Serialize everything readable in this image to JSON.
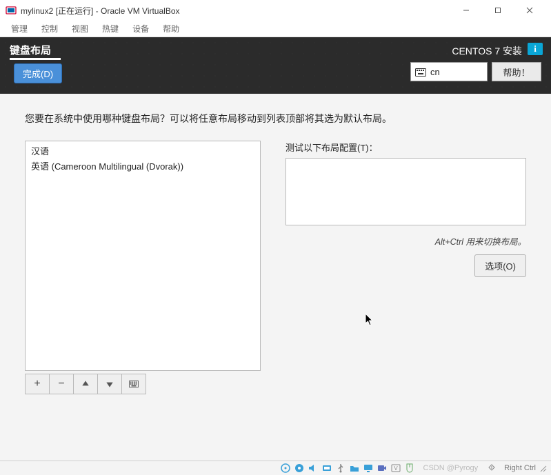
{
  "vb": {
    "title": "mylinux2 [正在运行] - Oracle VM VirtualBox",
    "menu": [
      "管理",
      "控制",
      "视图",
      "热键",
      "设备",
      "帮助"
    ],
    "status": {
      "watermark": "CSDN @Pyrogy",
      "hostkey": "Right Ctrl"
    }
  },
  "anaconda": {
    "heading": "键盘布局",
    "done": "完成(D)",
    "brand": "CENTOS 7 安装",
    "lang_code": "cn",
    "help": "帮助！",
    "prompt": "您要在系统中使用哪种键盘布局？可以将任意布局移动到列表顶部将其选为默认布局。",
    "layouts": [
      "汉语",
      "英语 (Cameroon Multilingual (Dvorak))"
    ],
    "test_label": "测试以下布局配置(T)：",
    "test_value": "",
    "switch_hint": "Alt+Ctrl 用来切换布局。",
    "options": "选项(O)",
    "toolbar": {
      "add": "+",
      "remove": "−",
      "up": "▴",
      "down": "▾"
    }
  }
}
